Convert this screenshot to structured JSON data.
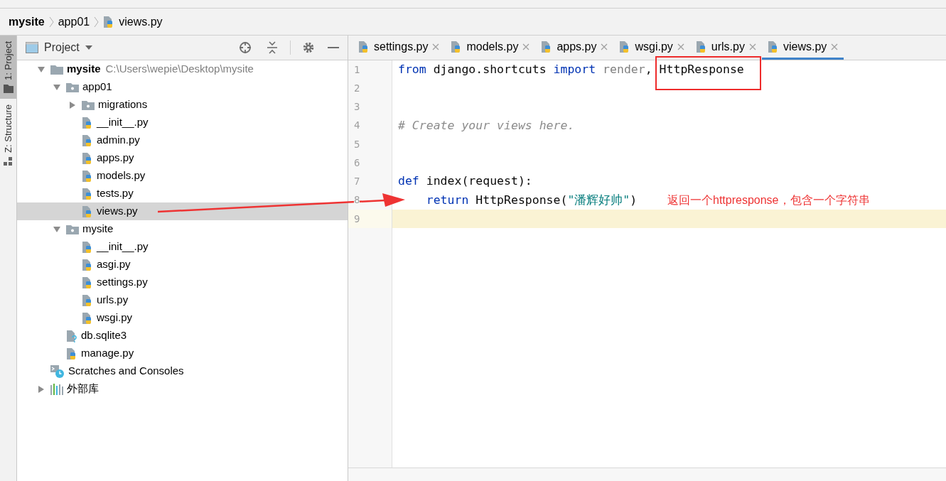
{
  "breadcrumb": [
    {
      "label": "mysite",
      "kind": "root"
    },
    {
      "label": "app01",
      "kind": "folder"
    },
    {
      "label": "views.py",
      "kind": "python"
    }
  ],
  "tool_strip": [
    {
      "label": "1: Project",
      "kind": "project",
      "selected": true
    },
    {
      "label": "Z: Structure",
      "kind": "structure",
      "selected": false
    }
  ],
  "project_panel": {
    "title": "Project",
    "tree": [
      {
        "label": "mysite",
        "path": "C:\\Users\\wepie\\Desktop\\mysite",
        "kind": "root",
        "expanded": true,
        "selected": false,
        "children": [
          {
            "label": "app01",
            "kind": "module",
            "expanded": true,
            "selected": false,
            "children": [
              {
                "label": "migrations",
                "kind": "module",
                "expanded": false,
                "selected": false
              },
              {
                "label": "__init__.py",
                "kind": "python",
                "selected": false
              },
              {
                "label": "admin.py",
                "kind": "python",
                "selected": false
              },
              {
                "label": "apps.py",
                "kind": "python",
                "selected": false
              },
              {
                "label": "models.py",
                "kind": "python",
                "selected": false
              },
              {
                "label": "tests.py",
                "kind": "python",
                "selected": false
              },
              {
                "label": "views.py",
                "kind": "python",
                "selected": true
              }
            ]
          },
          {
            "label": "mysite",
            "kind": "module",
            "expanded": true,
            "selected": false,
            "children": [
              {
                "label": "__init__.py",
                "kind": "python",
                "selected": false
              },
              {
                "label": "asgi.py",
                "kind": "python",
                "selected": false
              },
              {
                "label": "settings.py",
                "kind": "python",
                "selected": false
              },
              {
                "label": "urls.py",
                "kind": "python",
                "selected": false
              },
              {
                "label": "wsgi.py",
                "kind": "python",
                "selected": false
              }
            ]
          },
          {
            "label": "db.sqlite3",
            "kind": "unknown",
            "selected": false
          },
          {
            "label": "manage.py",
            "kind": "python",
            "selected": false
          }
        ]
      },
      {
        "label": "Scratches and Consoles",
        "kind": "scratches",
        "selected": false
      },
      {
        "label": "外部库",
        "kind": "library",
        "expanded": false,
        "selected": false
      }
    ]
  },
  "editor": {
    "tabs": [
      {
        "label": "settings.py",
        "selected": false
      },
      {
        "label": "models.py",
        "selected": false
      },
      {
        "label": "apps.py",
        "selected": false
      },
      {
        "label": "wsgi.py",
        "selected": false
      },
      {
        "label": "urls.py",
        "selected": false
      },
      {
        "label": "views.py",
        "selected": true
      }
    ],
    "lines": [
      {
        "number": "1",
        "current": false,
        "tokens": [
          {
            "text": "from",
            "kind": "keyword"
          },
          {
            "text": " django.shortcuts ",
            "kind": "plain"
          },
          {
            "text": "import",
            "kind": "keyword"
          },
          {
            "text": " render",
            "kind": "unused"
          },
          {
            "text": ", ",
            "kind": "plain"
          },
          {
            "text": "HttpResponse",
            "kind": "plain"
          }
        ]
      },
      {
        "number": "2",
        "current": false
      },
      {
        "number": "3",
        "current": false
      },
      {
        "number": "4",
        "current": false,
        "tokens": [
          {
            "text": "# Create your views here.",
            "kind": "comment"
          }
        ]
      },
      {
        "number": "5",
        "current": false
      },
      {
        "number": "6",
        "current": false
      },
      {
        "number": "7",
        "current": false,
        "tokens": [
          {
            "text": "def",
            "kind": "keyword"
          },
          {
            "text": " index(request):",
            "kind": "plain"
          }
        ]
      },
      {
        "number": "8",
        "current": false,
        "tokens": [
          {
            "text": "    return",
            "kind": "keyword"
          },
          {
            "text": " HttpResponse(",
            "kind": "plain"
          },
          {
            "text": "\"潘辉好帅\"",
            "kind": "string"
          },
          {
            "text": ")",
            "kind": "plain"
          }
        ]
      },
      {
        "number": "9",
        "current": true
      }
    ]
  },
  "annotation": {
    "text": "返回一个httpresponse，包含一个字符串"
  }
}
